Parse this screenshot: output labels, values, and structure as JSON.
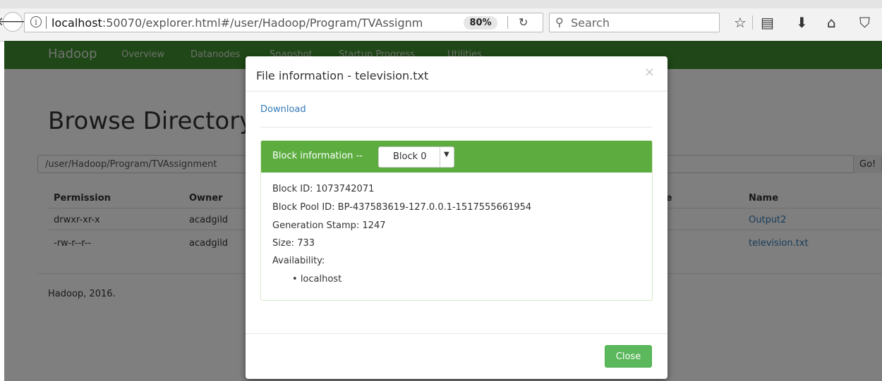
{
  "browser": {
    "url_host": "localhost",
    "url_rest": ":50070/explorer.html#/user/Hadoop/Program/TVAssignm",
    "zoom": "80%",
    "search_placeholder": "Search"
  },
  "nav": {
    "brand": "Hadoop",
    "items": [
      "Overview",
      "Datanodes",
      "Snapshot",
      "Startup Progress",
      "Utilities"
    ]
  },
  "browse": {
    "heading": "Browse Directory",
    "path": "/user/Hadoop/Program/TVAssignment",
    "go_label": "Go!",
    "columns": {
      "permission": "Permission",
      "owner": "Owner",
      "size": "ze",
      "name": "Name"
    },
    "rows": [
      {
        "permission": "drwxr-xr-x",
        "owner": "acadgild",
        "name": "Output2"
      },
      {
        "permission": "-rw-r--r--",
        "owner": "acadgild",
        "name": "television.txt"
      }
    ],
    "footer": "Hadoop, 2016."
  },
  "modal": {
    "title": "File information - television.txt",
    "close_symbol": "×",
    "download_label": "Download",
    "block_header_label": "Block information --",
    "block_selected": "Block 0",
    "block_id": "Block ID: 1073742071",
    "block_pool_id": "Block Pool ID: BP-437583619-127.0.0.1-1517555661954",
    "generation_stamp": "Generation Stamp: 1247",
    "size": "Size: 733",
    "availability_label": "Availability:",
    "availability_hosts": [
      "localhost"
    ],
    "close_button": "Close"
  },
  "colors": {
    "navbar": "#3f8f2f",
    "panel_header": "#5cac3f",
    "close_button": "#5cb85c",
    "link": "#337ab7"
  }
}
